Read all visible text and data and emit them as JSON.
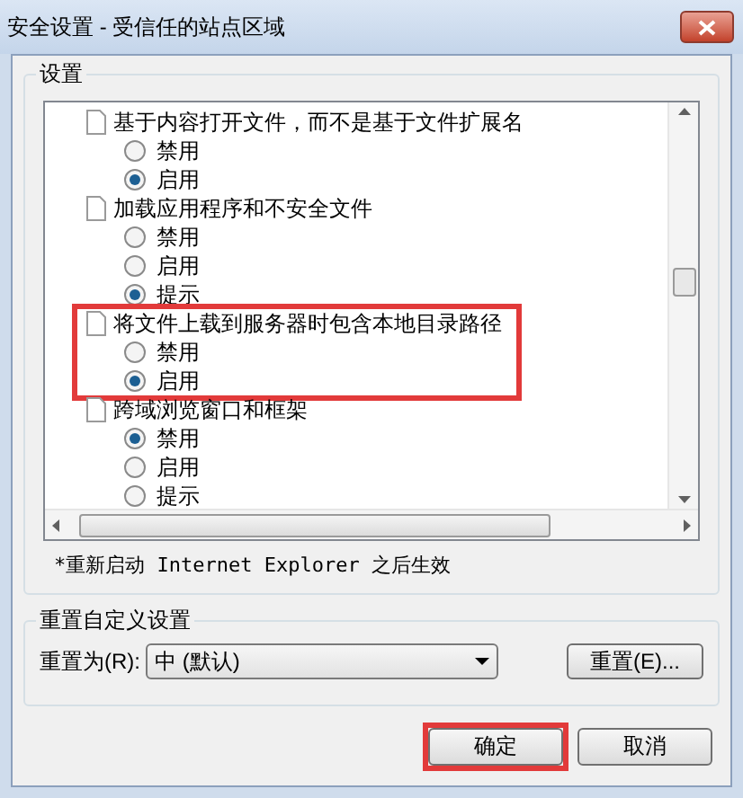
{
  "window": {
    "title": "安全设置 - 受信任的站点区域"
  },
  "settings": {
    "title": "设置",
    "items": [
      {
        "label": "基于内容打开文件，而不是基于文件扩展名",
        "highlighted": false,
        "options": [
          {
            "label": "禁用",
            "selected": false
          },
          {
            "label": "启用",
            "selected": true
          }
        ]
      },
      {
        "label": "加载应用程序和不安全文件",
        "highlighted": false,
        "options": [
          {
            "label": "禁用",
            "selected": false
          },
          {
            "label": "启用",
            "selected": false
          },
          {
            "label": "提示",
            "selected": true
          }
        ]
      },
      {
        "label": "将文件上载到服务器时包含本地目录路径",
        "highlighted": true,
        "options": [
          {
            "label": "禁用",
            "selected": false
          },
          {
            "label": "启用",
            "selected": true
          }
        ]
      },
      {
        "label": "跨域浏览窗口和框架",
        "highlighted": false,
        "options": [
          {
            "label": "禁用",
            "selected": true
          },
          {
            "label": "启用",
            "selected": false
          },
          {
            "label": "提示",
            "selected": false
          }
        ]
      }
    ],
    "note": "*重新启动 Internet Explorer 之后生效"
  },
  "reset": {
    "title": "重置自定义设置",
    "label": "重置为(R):",
    "value": "中 (默认)",
    "button": "重置(E)..."
  },
  "buttons": [
    {
      "label": "确定",
      "highlighted": true
    },
    {
      "label": "取消",
      "highlighted": false
    }
  ]
}
